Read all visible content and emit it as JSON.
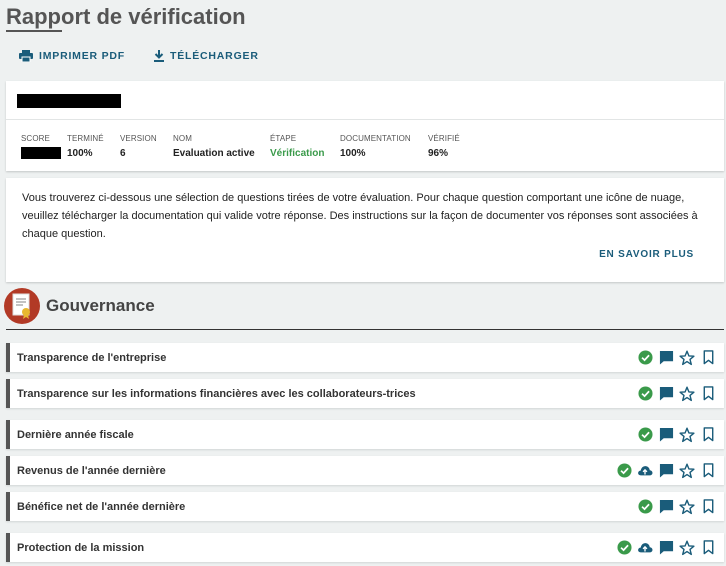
{
  "header": {
    "title": "Rapport de vérification",
    "print_label": "IMPRIMER PDF",
    "download_label": "TÉLÉCHARGER"
  },
  "summary": {
    "stats": [
      {
        "label": "SCORE",
        "value": ""
      },
      {
        "label": "TERMINÉ",
        "value": "100%"
      },
      {
        "label": "VERSION",
        "value": "6"
      },
      {
        "label": "NOM",
        "value": "Evaluation active"
      },
      {
        "label": "ÉTAPE",
        "value": "Vérification"
      },
      {
        "label": "DOCUMENTATION",
        "value": "100%"
      },
      {
        "label": "VÉRIFIÉ",
        "value": "96%"
      }
    ]
  },
  "info": {
    "text": "Vous trouverez ci-dessous une sélection de questions tirées de votre évaluation. Pour chaque question comportant une icône de nuage, veuillez télécharger la documentation qui valide votre réponse. Des instructions sur la façon de documenter vos réponses sont associées à chaque question.",
    "learn_more": "EN SAVOIR PLUS"
  },
  "section": {
    "title": "Gouvernance",
    "questions": [
      {
        "label": "Transparence de l'entreprise",
        "upload": false
      },
      {
        "label": "Transparence sur les informations financières avec les collaborateurs-trices",
        "upload": false
      },
      {
        "label": "Dernière année fiscale",
        "upload": false
      },
      {
        "label": "Revenus de l'année dernière",
        "upload": true
      },
      {
        "label": "Bénéfice net de l'année dernière",
        "upload": false
      },
      {
        "label": "Protection de la mission",
        "upload": true
      }
    ]
  },
  "colors": {
    "accent": "#1a5c7a",
    "check": "#3a9a4a",
    "section_icon": "#b23a26"
  }
}
